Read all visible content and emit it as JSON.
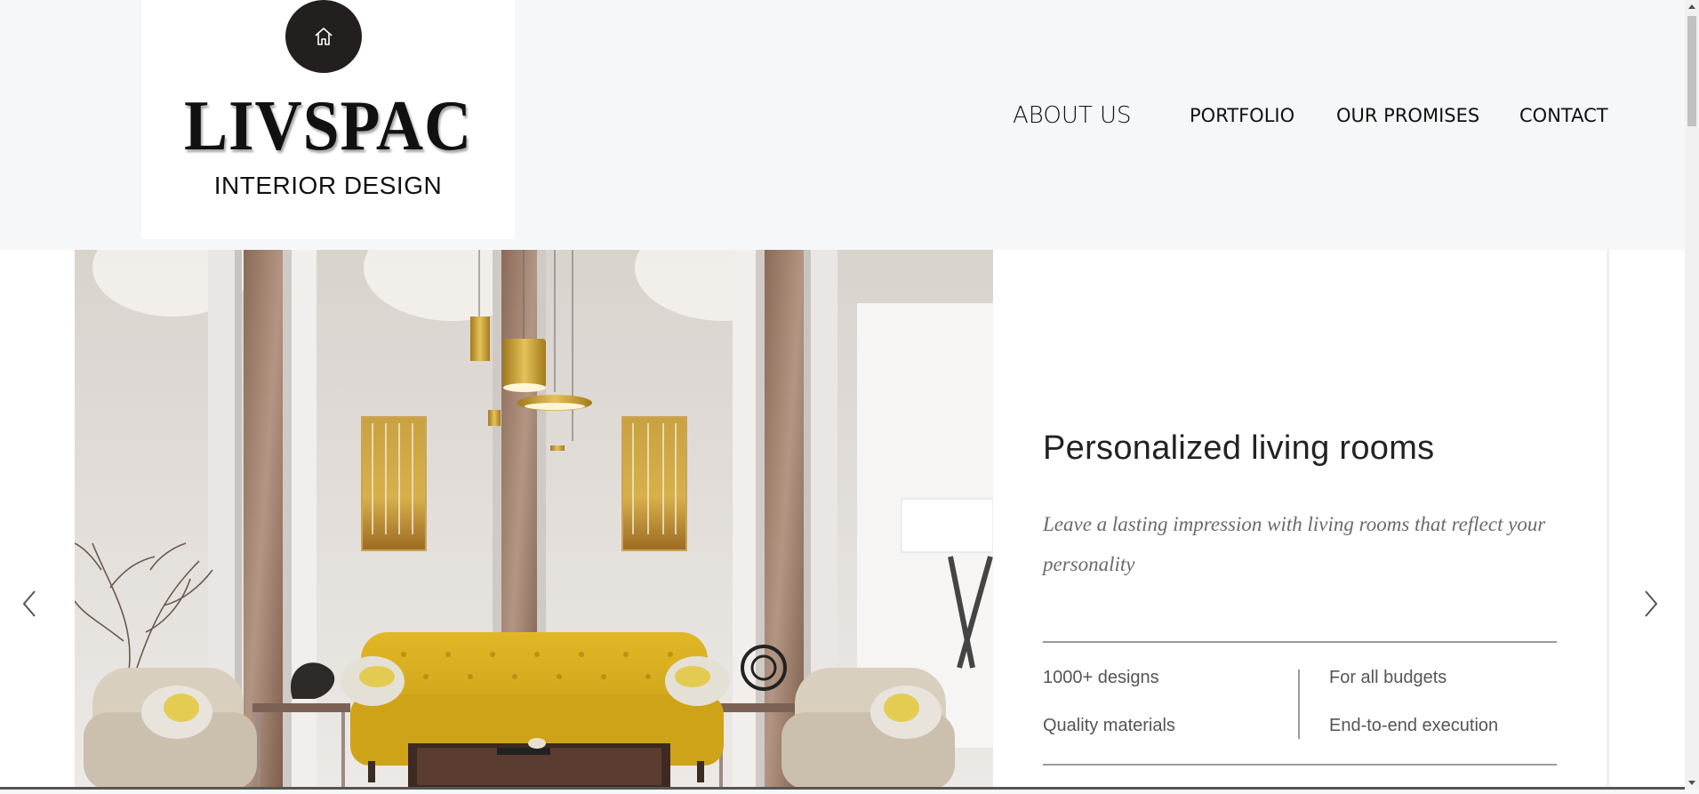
{
  "logo": {
    "icon": "home-icon",
    "wordmark": "LIVSPAC",
    "tagline": "INTERIOR DESIGN"
  },
  "nav": {
    "items": [
      {
        "label": "ABOUT US"
      },
      {
        "label": "PORTFOLIO"
      },
      {
        "label": "OUR PROMISES"
      },
      {
        "label": "CONTACT"
      }
    ]
  },
  "slide": {
    "image": "living room with yellow tufted sofa, two beige armchairs, pendant lights and gold artwork",
    "title": "Personalized living rooms",
    "description": "Leave a lasting impression with living rooms that reflect your personality",
    "features": [
      "1000+ designs",
      "For all budgets",
      "Quality materials",
      "End-to-end execution"
    ]
  },
  "controls": {
    "prev_icon": "chevron-left-icon",
    "next_icon": "chevron-right-icon"
  },
  "colors": {
    "page_bg": "#f6f7f9",
    "logo_circle": "#231f1e",
    "sofa_yellow": "#d4aa1a",
    "text_muted": "#6a6a6a"
  }
}
